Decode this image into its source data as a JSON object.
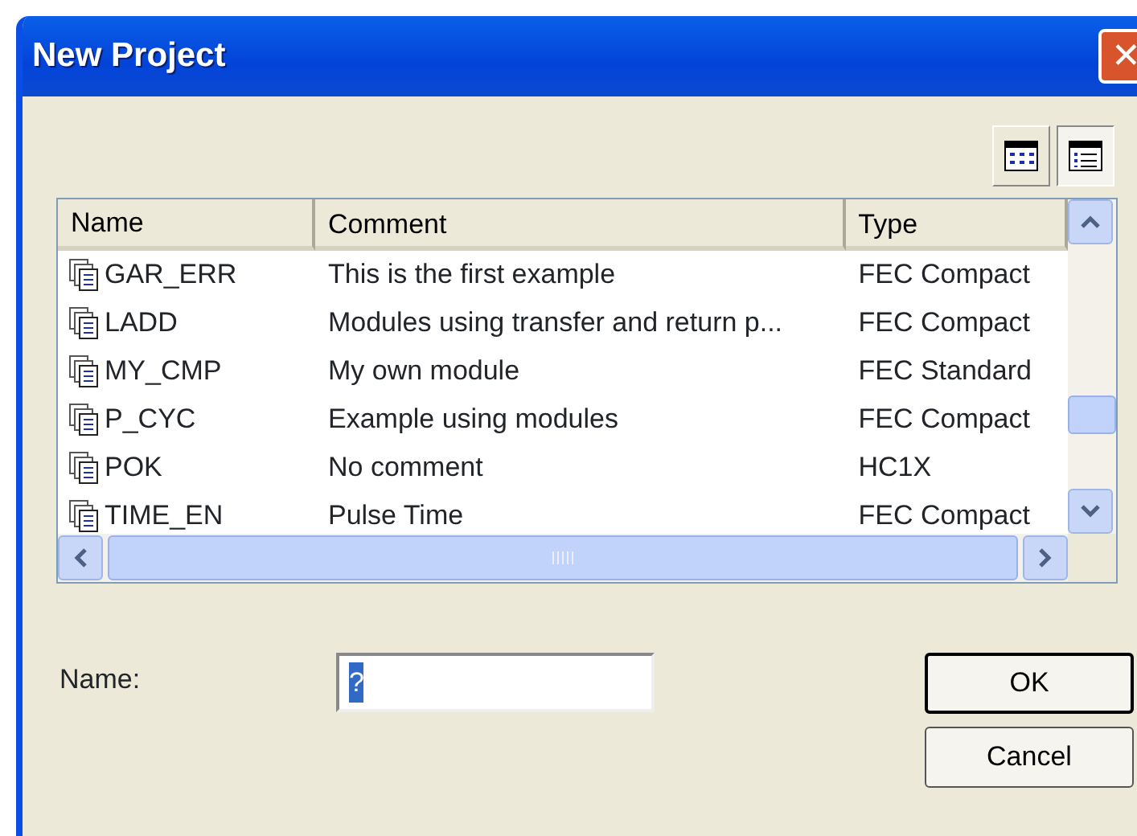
{
  "window": {
    "title": "New Project",
    "close": "✕"
  },
  "view_buttons": [
    {
      "kind": "icons",
      "selected": false
    },
    {
      "kind": "details",
      "selected": true
    }
  ],
  "list": {
    "columns": [
      "Name",
      "Comment",
      "Type"
    ],
    "rows": [
      {
        "name": "GAR_ERR",
        "comment": "This is the first example",
        "type": "FEC Compact"
      },
      {
        "name": "LADD",
        "comment": "Modules using transfer and return p...",
        "type": "FEC Compact"
      },
      {
        "name": "MY_CMP",
        "comment": "My own module",
        "type": "FEC Standard"
      },
      {
        "name": "P_CYC",
        "comment": "Example using modules",
        "type": "FEC Compact"
      },
      {
        "name": "POK",
        "comment": "No comment",
        "type": "HC1X"
      },
      {
        "name": "TIME_EN",
        "comment": "Pulse Time",
        "type": "FEC Compact"
      }
    ]
  },
  "name_field": {
    "label": "Name:",
    "value": "?"
  },
  "buttons": [
    {
      "label": "OK",
      "default": true
    },
    {
      "label": "Cancel",
      "default": false
    }
  ]
}
